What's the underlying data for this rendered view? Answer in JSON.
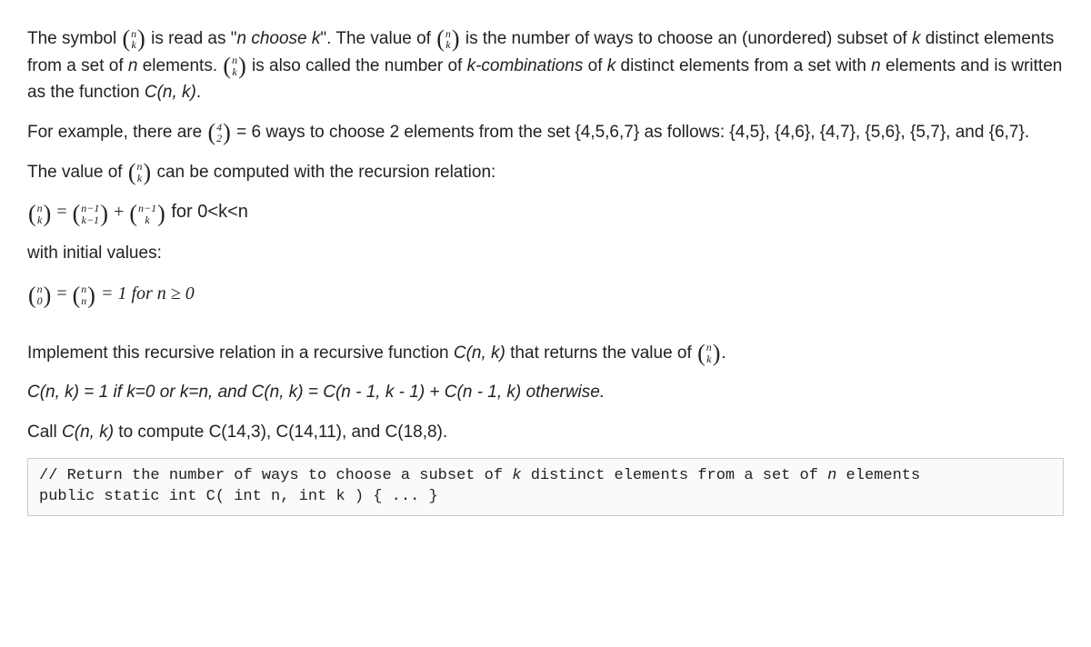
{
  "p1_a": "The symbol ",
  "b_nk_top": "n",
  "b_nk_bot": "k",
  "p1_b": " is read as \"",
  "p1_c": "n choose k",
  "p1_d": "\". The value of ",
  "p1_e": " is the number of ways to choose an (unordered) subset of ",
  "p1_f": "k",
  "p1_g": " distinct elements from a set of ",
  "p1_h": "n",
  "p1_i": " elements. ",
  "p1_j": " is also called the number of ",
  "p1_k": "k-combinations",
  "p1_l": " of ",
  "p1_m": "k",
  "p1_n": " distinct elements from a set with ",
  "p1_o": "n",
  "p1_p": " elements and is written as the function ",
  "p1_q": "C(n, k)",
  "p1_r": ".",
  "p2_a": "For example, there are ",
  "b_42_top": "4",
  "b_42_bot": "2",
  "p2_b": " = 6 ways to choose 2 elements from the set {4,5,6,7}  as follows: {4,5}, {4,6}, {4,7}, {5,6}, {5,7}, and {6,7}.",
  "p3_a": "The value of ",
  "p3_b": " can be computed with the recursion relation:",
  "eq1_eq": " = ",
  "b_nm1km1_top": "n−1",
  "b_nm1km1_bot": "k−1",
  "eq1_plus": " + ",
  "b_nm1k_top": "n−1",
  "b_nm1k_bot": "k",
  "eq1_tail": " for 0<k<n",
  "p4": "with initial values:",
  "b_n0_top": "n",
  "b_n0_bot": "0",
  "b_nn_top": "n",
  "b_nn_bot": "n",
  "eq2_body": " = 1 for n ≥ 0",
  "p5_a": "Implement this recursive relation in a recursive function ",
  "p5_b": "C(n, k)",
  "p5_c": " that returns the value of ",
  "p5_d": ".",
  "p6": "C(n, k) = 1 if k=0 or k=n, and C(n, k) = C(n - 1, k - 1) + C(n - 1, k) otherwise.",
  "p7_a": "Call ",
  "p7_b": "C(n, k)",
  "p7_c": " to compute C(14,3), C(14,11), and C(18,8).",
  "code_l1_a": "// Return the number of ways to choose a subset of ",
  "code_l1_b": "k",
  "code_l1_c": " distinct elements from a set of ",
  "code_l1_d": "n",
  "code_l1_e": " elements",
  "code_l2": "public static int C( int n, int k ) { ... }"
}
